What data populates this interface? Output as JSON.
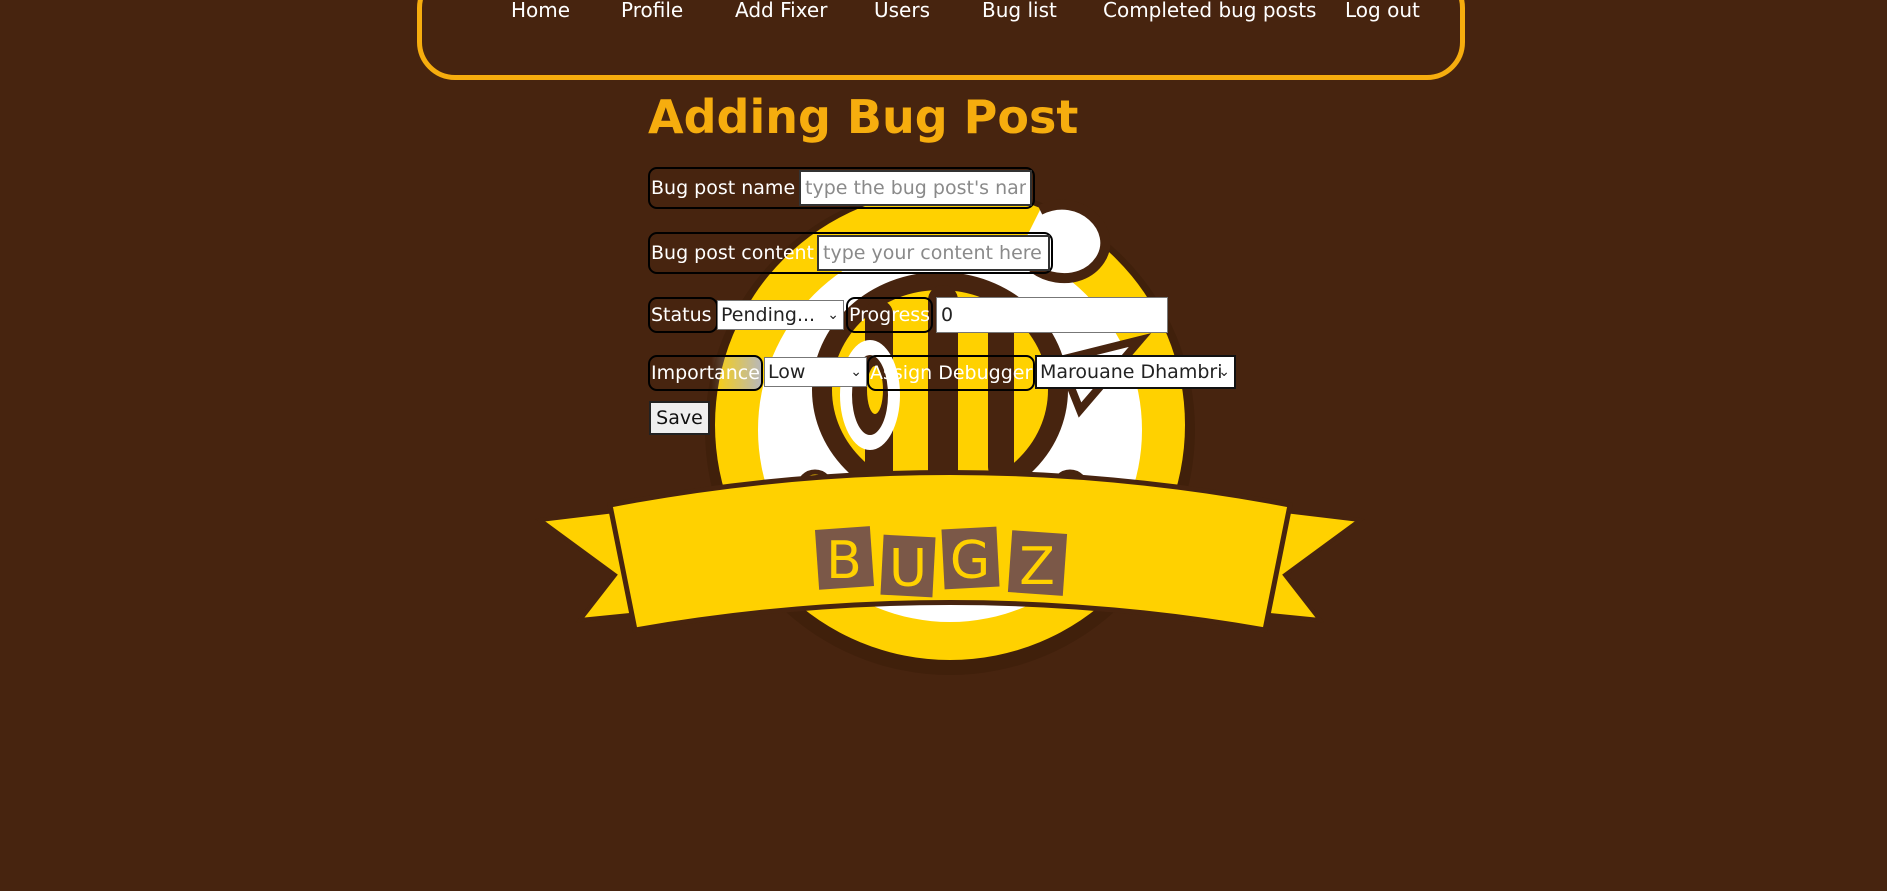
{
  "nav": {
    "home": "Home",
    "profile": "Profile",
    "add_fixer": "Add Fixer",
    "users": "Users",
    "bug_list": "Bug list",
    "completed_bug_posts": "Completed bug posts",
    "log_out": "Log out"
  },
  "logo": {
    "text": "BUGZ",
    "letters": [
      "B",
      "U",
      "G",
      "Z"
    ],
    "icon": "bee-icon"
  },
  "form": {
    "title": "Adding Bug Post",
    "name_label": "Bug post name :",
    "name_placeholder": "type the bug post's name",
    "name_value": "",
    "content_label": "Bug post content :",
    "content_placeholder": "type your content here",
    "content_value": "",
    "status_label": "Status :",
    "status_value": "Pending...",
    "progress_label": "Progress :",
    "progress_value": "0",
    "importance_label": "Importance :",
    "importance_value": "Low",
    "debugger_label": "Assign Debugger :",
    "debugger_value": "Marouane Dhambri",
    "save_label": "Save"
  },
  "colors": {
    "background": "#47240f",
    "accent": "#f6ad0e",
    "logo_yellow": "#ffd100",
    "logo_brown": "#47240f",
    "logo_box": "#7b5848"
  }
}
